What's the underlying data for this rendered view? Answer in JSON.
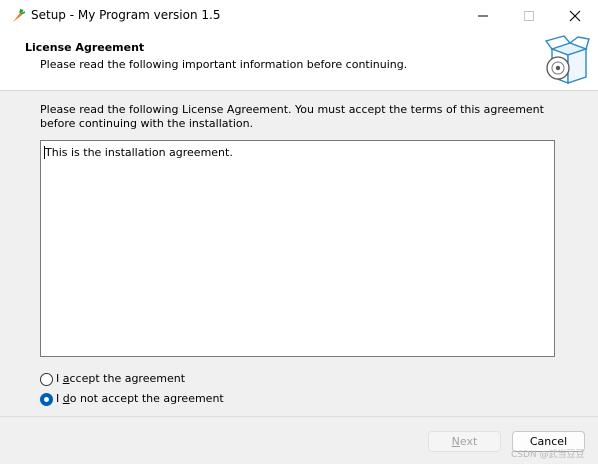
{
  "window": {
    "title": "Setup - My Program version 1.5",
    "icons": {
      "app": "carrot-icon",
      "minimize": "minimize-icon",
      "maximize": "maximize-icon",
      "close": "close-icon"
    }
  },
  "header": {
    "title": "License Agreement",
    "subtitle": "Please read the following important information before continuing.",
    "image": "setup-box-icon"
  },
  "instructions": "Please read the following License Agreement. You must accept the terms of this agreement before continuing with the installation.",
  "license": {
    "text": "This is the installation agreement."
  },
  "options": {
    "accept": {
      "label_prefix": "I ",
      "mnemonic": "a",
      "label_rest": "ccept the agreement",
      "selected": false
    },
    "decline": {
      "label_prefix": "I ",
      "mnemonic": "d",
      "label_rest": "o not accept the agreement",
      "selected": true
    }
  },
  "buttons": {
    "next": {
      "mnemonic": "N",
      "label_rest": "ext",
      "enabled": false
    },
    "cancel": {
      "label": "Cancel"
    }
  },
  "watermark": "CSDN @武当豆豆",
  "colors": {
    "accent": "#005fb8",
    "disabled_text": "#a3a3a3"
  }
}
